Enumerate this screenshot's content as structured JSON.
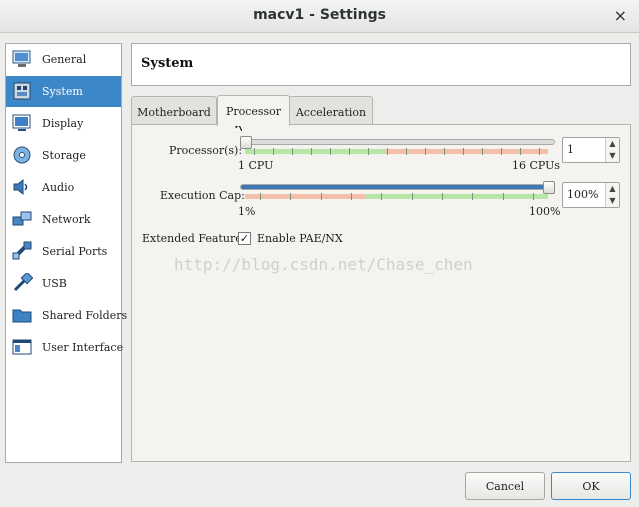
{
  "window": {
    "title": "macv1 - Settings",
    "close_glyph": "×"
  },
  "sidebar": {
    "items": [
      {
        "label": "General",
        "icon": "general-monitor-icon",
        "selected": false
      },
      {
        "label": "System",
        "icon": "system-chip-icon",
        "selected": true
      },
      {
        "label": "Display",
        "icon": "display-monitor-icon",
        "selected": false
      },
      {
        "label": "Storage",
        "icon": "storage-disk-icon",
        "selected": false
      },
      {
        "label": "Audio",
        "icon": "audio-speaker-icon",
        "selected": false
      },
      {
        "label": "Network",
        "icon": "network-icon",
        "selected": false
      },
      {
        "label": "Serial Ports",
        "icon": "serial-port-icon",
        "selected": false
      },
      {
        "label": "USB",
        "icon": "usb-icon",
        "selected": false
      },
      {
        "label": "Shared Folders",
        "icon": "shared-folder-icon",
        "selected": false
      },
      {
        "label": "User Interface",
        "icon": "user-interface-icon",
        "selected": false
      }
    ]
  },
  "header": {
    "title": "System"
  },
  "tabs": [
    {
      "label": "Motherboard",
      "active": false
    },
    {
      "label": "Processor",
      "active": true
    },
    {
      "label": "Acceleration",
      "active": false
    }
  ],
  "processor": {
    "cpus_label": "Processor(s):",
    "cpus_min_label": "1 CPU",
    "cpus_max_label": "16 CPUs",
    "cpus_value": "1",
    "cpus_min": 1,
    "cpus_max": 16,
    "cpus_current": 1,
    "cap_label": "Execution Cap:",
    "cap_min_label": "1%",
    "cap_max_label": "100%",
    "cap_value": "100%",
    "cap_current": 100,
    "extended_label": "Extended Features:",
    "pae_label": "Enable PAE/NX",
    "pae_checked": true,
    "check_glyph": "✓"
  },
  "watermark": "http://blog.csdn.net/Chase_chen",
  "buttons": {
    "cancel": "Cancel",
    "ok": "OK"
  },
  "colors": {
    "selection": "#3c87c8",
    "slider_good": "#b8e6a6",
    "slider_bad": "#f4c0aa",
    "slider_fill": "#3c78b4"
  }
}
